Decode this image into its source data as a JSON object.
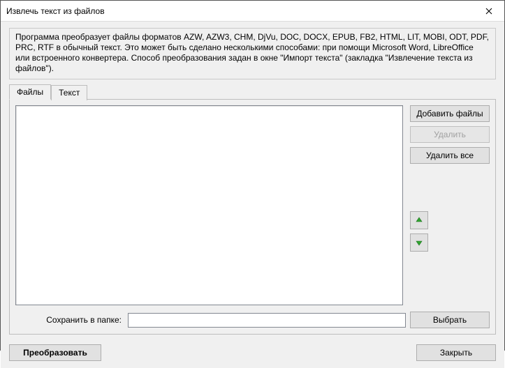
{
  "window": {
    "title": "Извлечь текст из файлов"
  },
  "description": "Программа преобразует файлы форматов AZW, AZW3, CHM, DjVu, DOC, DOCX, EPUB, FB2, HTML, LIT, MOBI, ODT, PDF, PRC, RTF в обычный текст. Это может быть сделано несколькими способами: при помощи Microsoft Word, LibreOffice или встроенного конвертера. Способ преобразования задан в окне \"Импорт текста\" (закладка \"Извлечение текста из файлов\").",
  "tabs": {
    "files": "Файлы",
    "text": "Текст"
  },
  "side": {
    "add": "Добавить файлы",
    "delete": "Удалить",
    "delete_all": "Удалить все"
  },
  "save": {
    "label": "Сохранить в папке:",
    "value": "",
    "choose": "Выбрать"
  },
  "bottom": {
    "convert": "Преобразовать",
    "close": "Закрыть"
  }
}
